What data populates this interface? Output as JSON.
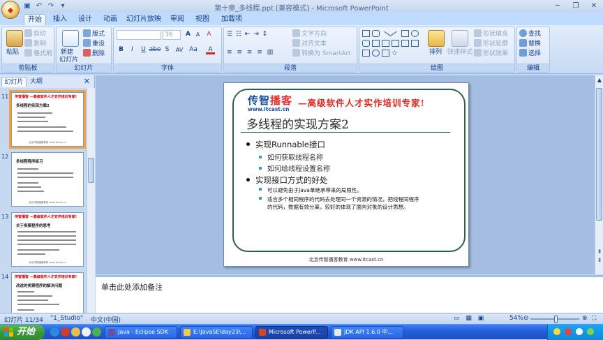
{
  "window": {
    "title": "第十章_多线程.ppt [兼容模式] - Microsoft PowerPoint",
    "controls": [
      "─",
      "❐",
      "✕"
    ]
  },
  "ribbon": {
    "tabs": [
      "开始",
      "插入",
      "设计",
      "动画",
      "幻灯片放映",
      "审阅",
      "视图",
      "加载项"
    ],
    "clipboard": {
      "label": "剪贴板",
      "paste": "粘贴",
      "cut": "剪切",
      "copy": "复制",
      "format_painter": "格式刷"
    },
    "slides": {
      "label": "幻灯片",
      "new_slide_1": "新建",
      "new_slide_2": "幻灯片",
      "layout": "版式",
      "reset": "重设",
      "delete": "删除"
    },
    "font": {
      "label": "字体",
      "font_size": "36",
      "bold": "B",
      "italic": "I",
      "underline": "U",
      "strike": "abe",
      "shadow": "S",
      "spacing": "AV",
      "case": "Aa",
      "grow": "A",
      "shrink": "A",
      "clear": "A",
      "color": "A"
    },
    "paragraph": {
      "label": "段落",
      "text_direction": "文字方向",
      "align_text": "对齐文本",
      "smartart": "转换为 SmartArt"
    },
    "drawing": {
      "label": "绘图",
      "arrange": "排列",
      "quick_styles": "快速样式",
      "shape_fill": "形状填充",
      "shape_outline": "形状轮廓",
      "shape_effects": "形状效果"
    },
    "editing": {
      "label": "编辑",
      "find": "查找",
      "replace": "替换",
      "select": "选择"
    }
  },
  "left_pane": {
    "tabs": [
      "幻灯片",
      "大纲"
    ],
    "close": "✕",
    "thumbnails": [
      {
        "num": "11",
        "head": "传智播客  —高级软件人才实作培训专家!",
        "title": "多线程的实现方案2"
      },
      {
        "num": "12",
        "head": "",
        "title": "多线程程序练习"
      },
      {
        "num": "13",
        "head": "传智播客  —高级软件人才实作培训专家!",
        "title": "关于卖票程序的思考"
      },
      {
        "num": "14",
        "head": "传智播客  —高级软件人才实作培训专家!",
        "title": "改进的卖票程序的解决问题"
      }
    ]
  },
  "slide": {
    "logo_cn_1": "传智",
    "logo_cn_2": "播客",
    "logo_url": "www.itcast.cn",
    "slogan": "—高级软件人才实作培训专家!",
    "title": "多线程的实现方案2",
    "bullets": [
      {
        "level": 1,
        "text": "实现Runnable接口"
      },
      {
        "level": 2,
        "text": "如何获取线程名称"
      },
      {
        "level": 2,
        "text": "如何给线程设置名称"
      },
      {
        "level": 1,
        "text": "实现接口方式的好处"
      },
      {
        "level": 3,
        "text": "可以避免由于Java单继承带来的局限性。"
      },
      {
        "level": 3,
        "text": "适合多个相同程序的代码去处理同一个资源的情况，把线程同程序"
      },
      {
        "level": 3,
        "text": "的代码，数据有效分离，较好的体现了面向对象的设计思想。"
      }
    ],
    "footer": "北京传智播客教育 www.itcast.cn"
  },
  "notes": {
    "placeholder": "单击此处添加备注"
  },
  "status": {
    "slide_info": "幻灯片 11/34",
    "theme": "\"1_Studio\"",
    "language": "中文(中国)",
    "zoom": "54%",
    "zoom_level": 0.54
  },
  "taskbar": {
    "start": "开始",
    "tasks": [
      "Java - Eclipse SDK",
      "E:\\JavaSE\\day23\\...",
      "Microsoft PowerP...",
      "JDK API 1.6.0 中..."
    ]
  }
}
